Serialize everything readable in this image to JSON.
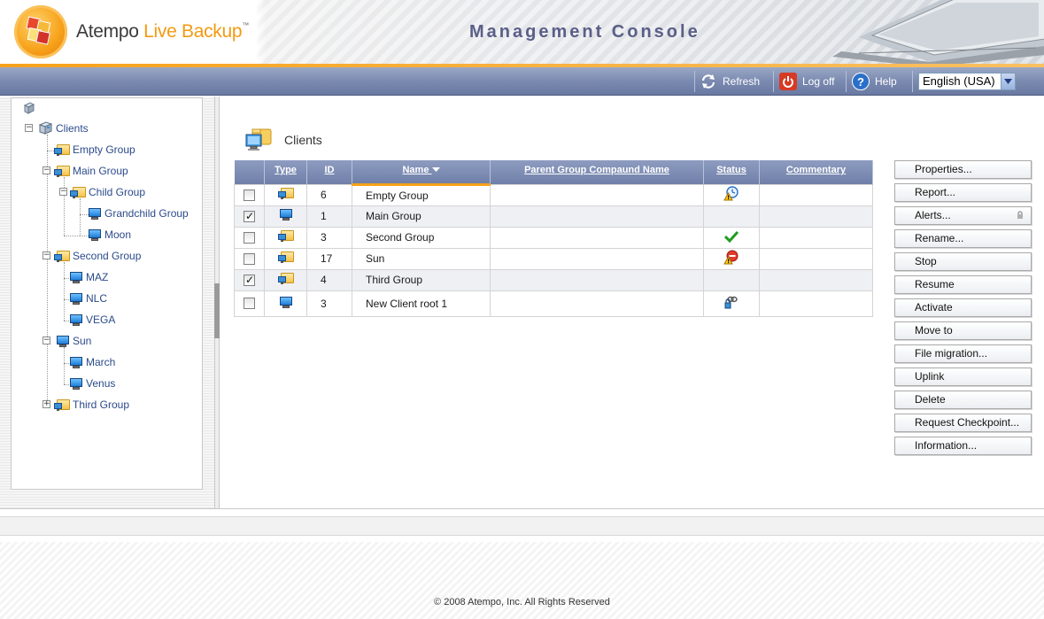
{
  "app": {
    "brand_part1": "Atempo",
    "brand_part2": "Live Backup",
    "brand_tm": "™",
    "console_title": "Management Console"
  },
  "toolbar": {
    "refresh_label": "Refresh",
    "logoff_label": "Log off",
    "help_label": "Help",
    "language": "English (USA)"
  },
  "tree": {
    "root_icon": "server-icon",
    "items": [
      {
        "label": "Clients",
        "icon": "clients-root-icon",
        "expander": "minus"
      },
      {
        "label": "Empty Group",
        "icon": "group-icon"
      },
      {
        "label": "Main Group",
        "icon": "group-icon",
        "expander": "minus"
      },
      {
        "label": "Child Group",
        "icon": "group-icon",
        "expander": "minus"
      },
      {
        "label": "Grandchild Group",
        "icon": "client-icon"
      },
      {
        "label": "Moon",
        "icon": "client-icon"
      },
      {
        "label": "Second Group",
        "icon": "group-icon",
        "expander": "minus"
      },
      {
        "label": "MAZ",
        "icon": "client-icon"
      },
      {
        "label": "NLC",
        "icon": "client-icon"
      },
      {
        "label": "VEGA",
        "icon": "client-icon"
      },
      {
        "label": "Sun",
        "icon": "client-icon",
        "expander": "minus"
      },
      {
        "label": "March",
        "icon": "client-icon"
      },
      {
        "label": "Venus",
        "icon": "client-icon"
      },
      {
        "label": "Third Group",
        "icon": "group-icon",
        "expander": "plus"
      }
    ]
  },
  "main": {
    "title": "Clients",
    "columns": [
      "Type",
      "ID",
      "Name",
      "Parent Group Compaund Name",
      "Status",
      "Commentary"
    ],
    "sort_column": "Name",
    "rows": [
      {
        "checked": false,
        "type": "group",
        "id": "6",
        "name": "Empty Group",
        "parent": "",
        "status": "warning-clock-icon",
        "commentary": ""
      },
      {
        "checked": true,
        "type": "client",
        "id": "1",
        "name": "Main Group",
        "parent": "",
        "status": "",
        "commentary": ""
      },
      {
        "checked": false,
        "type": "group",
        "id": "3",
        "name": "Second Group",
        "parent": "",
        "status": "ok-check-icon",
        "commentary": ""
      },
      {
        "checked": false,
        "type": "group",
        "id": "17",
        "name": "Sun",
        "parent": "",
        "status": "error-warning-icon",
        "commentary": ""
      },
      {
        "checked": true,
        "type": "group",
        "id": "4",
        "name": "Third Group",
        "parent": "",
        "status": "",
        "commentary": ""
      },
      {
        "checked": false,
        "type": "client",
        "id": "3",
        "name": "New Client root 1",
        "parent": "",
        "status": "locked-link-icon",
        "commentary": ""
      }
    ]
  },
  "actions": [
    {
      "label": "Properties..."
    },
    {
      "label": "Report..."
    },
    {
      "label": "Alerts...",
      "locked": true
    },
    {
      "label": "Rename..."
    },
    {
      "label": "Stop"
    },
    {
      "label": "Resume"
    },
    {
      "label": "Activate"
    },
    {
      "label": "Move to"
    },
    {
      "label": "File migration..."
    },
    {
      "label": "Uplink"
    },
    {
      "label": "Delete"
    },
    {
      "label": "Request Checkpoint..."
    },
    {
      "label": "Information..."
    }
  ],
  "footer": {
    "copyright": "© 2008 Atempo, Inc. All Rights Reserved"
  },
  "colors": {
    "brand_orange": "#f39a12",
    "toolbar_blue": "#7b8ab0",
    "header_blue": "#8e9cc0",
    "title_purple": "#5a5f88",
    "tree_link": "#2b4a8b"
  }
}
